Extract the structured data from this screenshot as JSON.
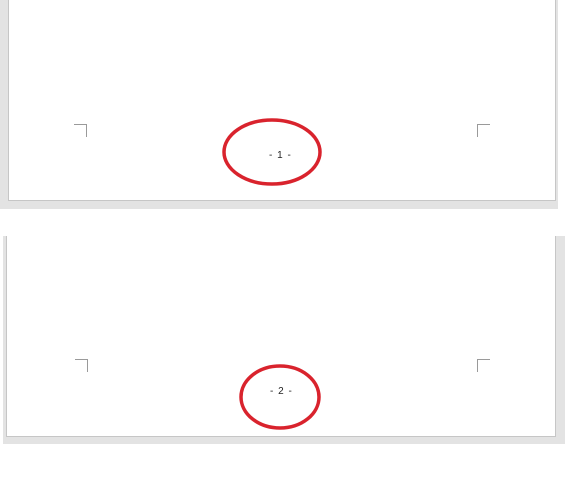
{
  "document": {
    "pages": [
      {
        "footer_page_number": "- 1 -"
      },
      {
        "footer_page_number": "- 2 -"
      }
    ]
  },
  "annotations": {
    "marker_color": "#d9232d",
    "marker_shape": "ellipse"
  },
  "colors": {
    "page_background": "#ffffff",
    "page_gap_background": "#e3e3e3",
    "corner_mark": "#9a9a9a"
  }
}
